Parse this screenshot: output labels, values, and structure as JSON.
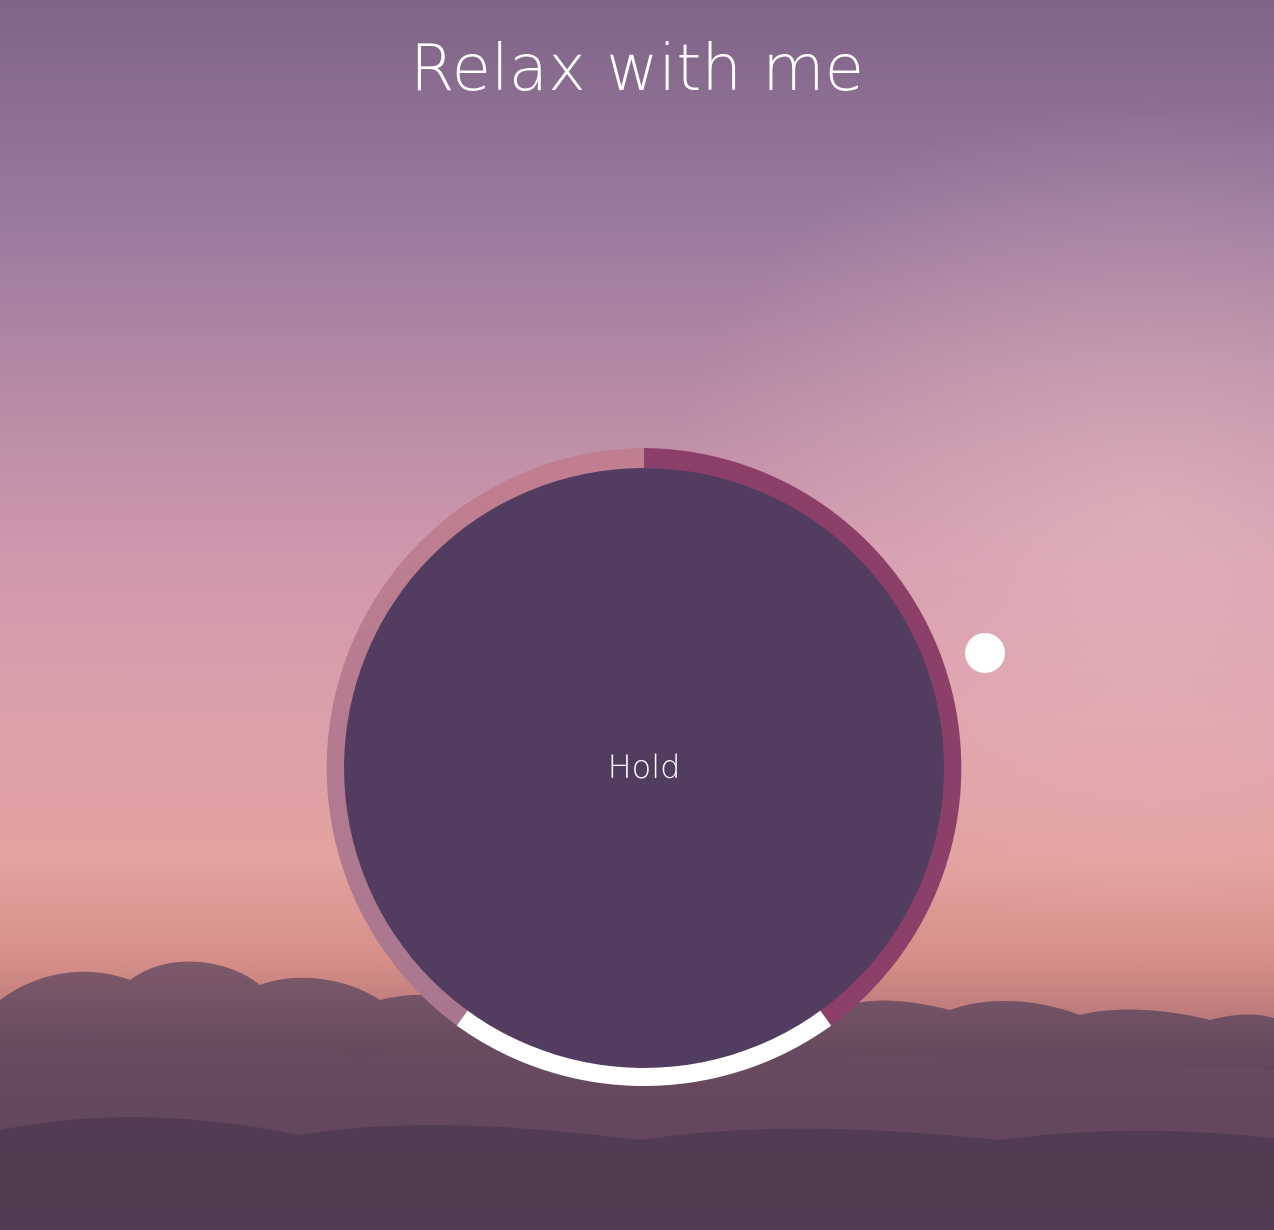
{
  "page": {
    "title": "Relax with me"
  },
  "breathing_guide": {
    "phase_label": "Hold",
    "colors": {
      "core": "#523d60",
      "segment_in": "#8c3f68",
      "segment_hold": "#ffffff",
      "segment_out": "#a8778f",
      "segment_out_top": "#c07f90"
    }
  },
  "background": {
    "description_icon": "sunset-clouds-background"
  }
}
